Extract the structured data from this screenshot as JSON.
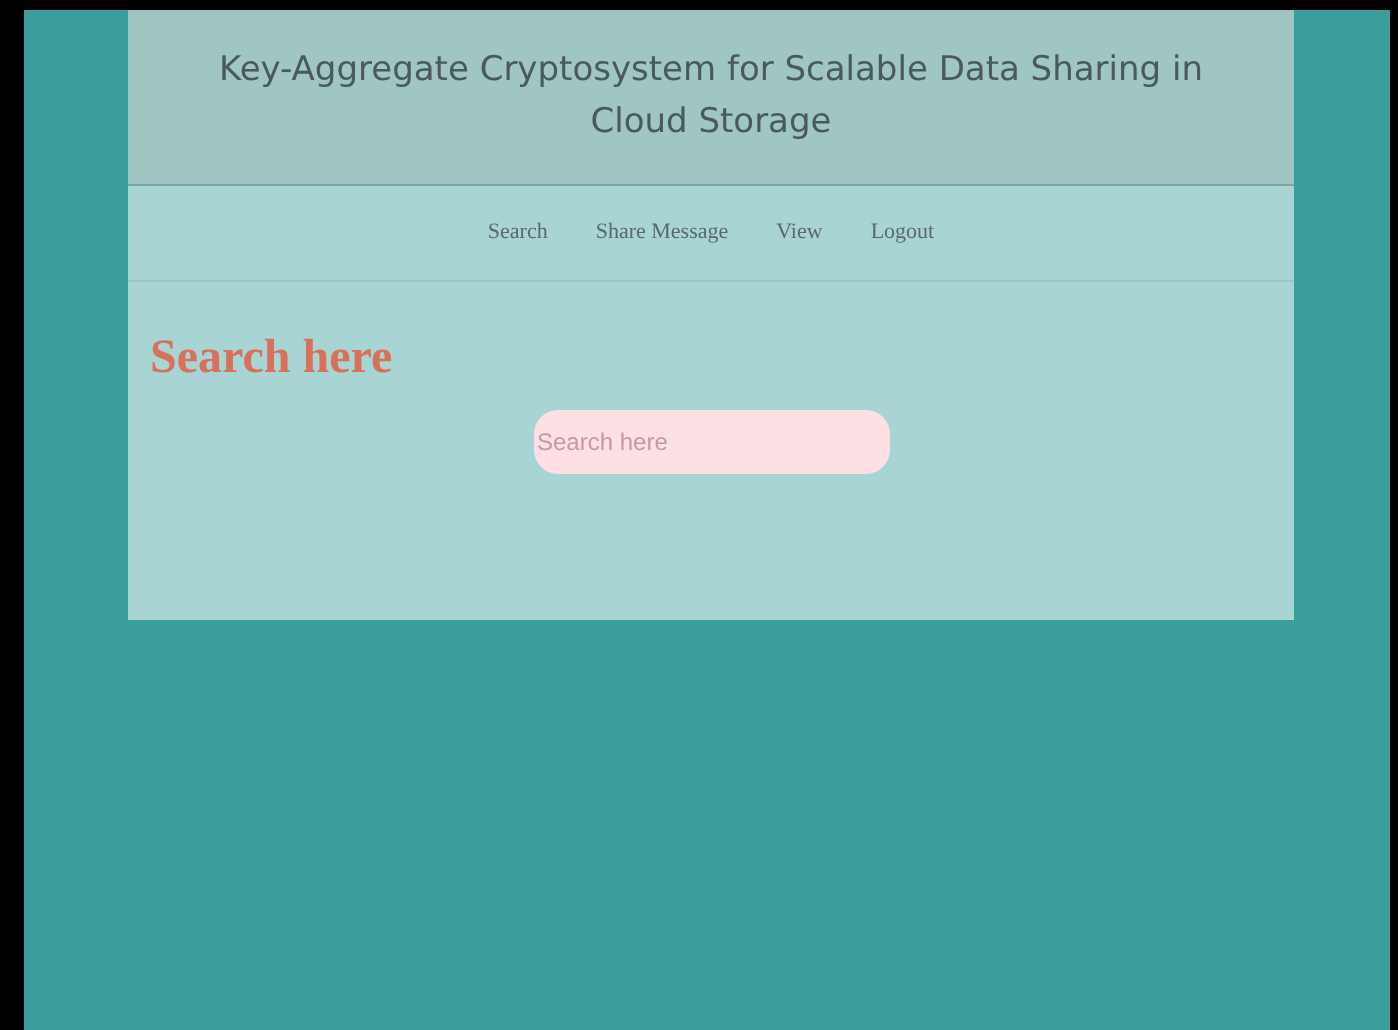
{
  "header": {
    "title": "Key-Aggregate Cryptosystem for Scalable Data Sharing in Cloud Storage"
  },
  "nav": [
    {
      "label": "Search"
    },
    {
      "label": "Share Message"
    },
    {
      "label": "View"
    },
    {
      "label": "Logout"
    }
  ],
  "heading": "Search here",
  "search": {
    "placeholder": "Search here"
  }
}
